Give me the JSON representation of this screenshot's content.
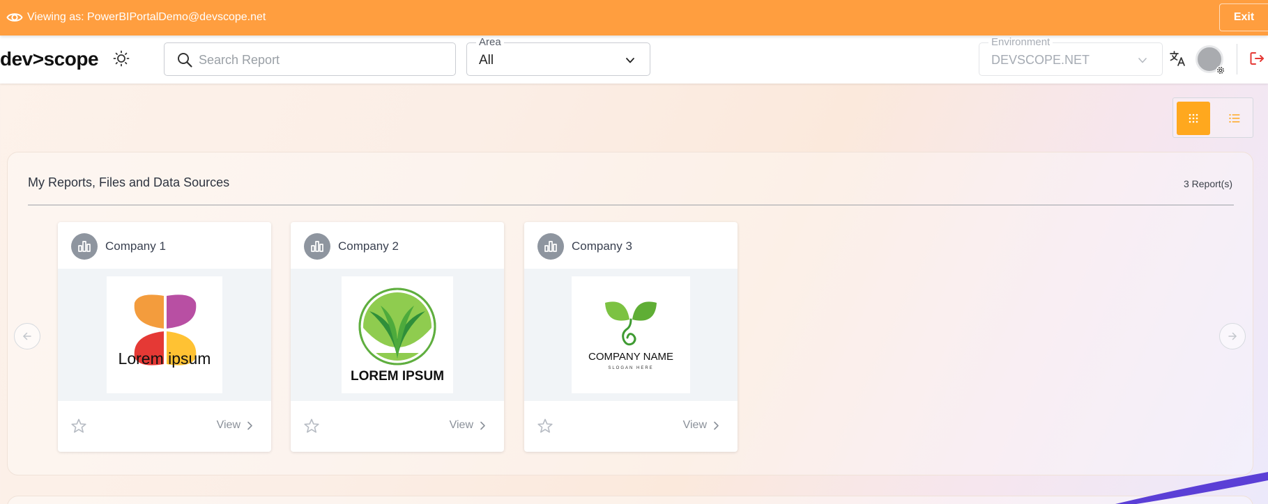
{
  "impersonation": {
    "viewing_label": "Viewing as: PowerBIPortalDemo@devscope.net",
    "exit_label": "Exit",
    "bar_color": "#ff9e3f"
  },
  "header": {
    "logo_text": "dev>scope",
    "search_placeholder": "Search Report",
    "area_legend": "Area",
    "area_value": "All",
    "environment_legend": "Environment",
    "environment_value": "DEVSCOPE.NET",
    "icons": [
      "sun-icon",
      "search-icon",
      "chevron-down-icon",
      "translate-icon",
      "avatar",
      "gear-icon",
      "logout-icon"
    ],
    "logout_color": "#e53935"
  },
  "view_toggle": {
    "active": "grid",
    "active_color": "#ffa81e",
    "icons": [
      "grid-icon",
      "list-icon"
    ]
  },
  "section": {
    "title": "My Reports, Files and Data Sources",
    "count": "3 Report(s)"
  },
  "reports": [
    {
      "name": "Company 1",
      "view_label": "View",
      "logo_text": "Lorem ipsum",
      "favorite": false
    },
    {
      "name": "Company 2",
      "view_label": "View",
      "logo_text": "LOREM IPSUM",
      "favorite": false
    },
    {
      "name": "Company 3",
      "view_label": "View",
      "logo_text": "COMPANY NAME",
      "logo_subtext": "SLOGAN HERE",
      "favorite": false
    }
  ],
  "carousel": {
    "icons": [
      "arrow-left-icon",
      "arrow-right-icon"
    ]
  }
}
